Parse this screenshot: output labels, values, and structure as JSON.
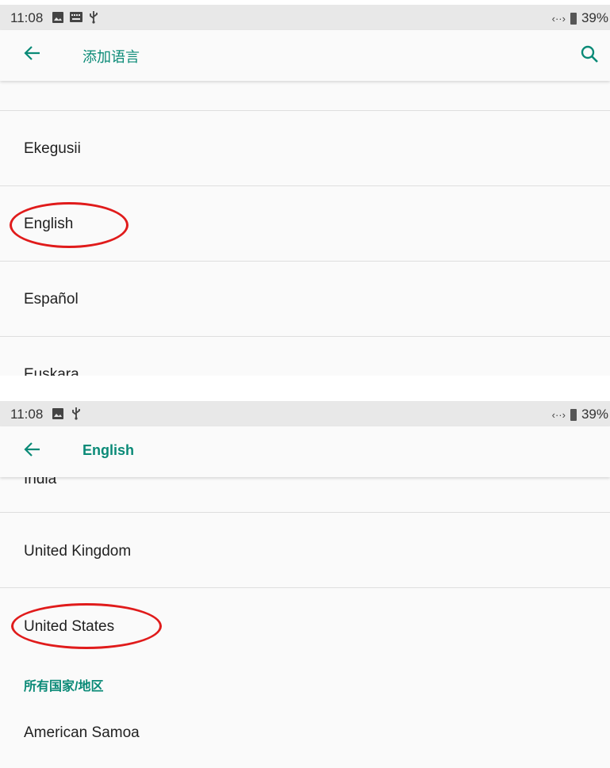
{
  "screen1": {
    "status": {
      "time": "11:08",
      "battery": "39%"
    },
    "appbar": {
      "title": "添加语言"
    },
    "items": [
      "Ekegusii",
      "English",
      "Español",
      "Euskara"
    ]
  },
  "screen2": {
    "status": {
      "time": "11:08",
      "battery": "39%"
    },
    "appbar": {
      "title": "English"
    },
    "suggested": [
      "India",
      "United Kingdom",
      "United States"
    ],
    "section_header": "所有国家/地区",
    "all_regions": [
      "American Samoa"
    ]
  },
  "colors": {
    "accent": "#0a8a77",
    "highlight": "#e01b1b",
    "statusbar": "#e8e8e8"
  }
}
